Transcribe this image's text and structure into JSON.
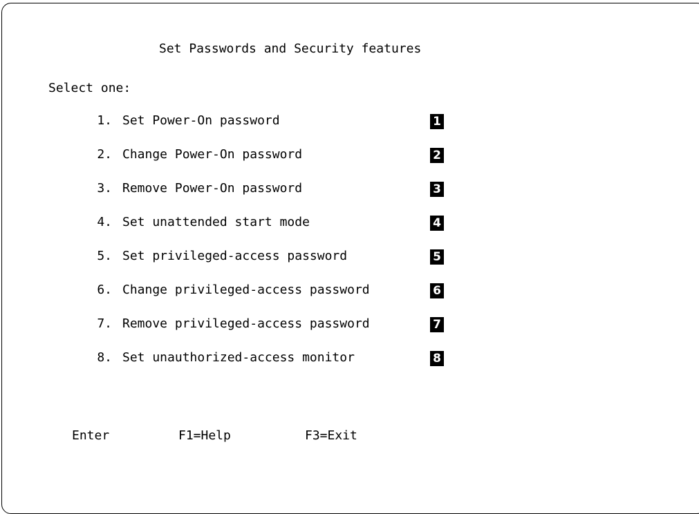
{
  "screen": {
    "title": "Set Passwords and Security features",
    "prompt": "Select one:"
  },
  "menu": {
    "items": [
      {
        "number": "1.",
        "label": "Set Power-On password",
        "callout": "1"
      },
      {
        "number": "2.",
        "label": "Change Power-On password",
        "callout": "2"
      },
      {
        "number": "3.",
        "label": "Remove Power-On password",
        "callout": "3"
      },
      {
        "number": "4.",
        "label": "Set unattended start mode",
        "callout": "4"
      },
      {
        "number": "5.",
        "label": "Set privileged-access password",
        "callout": "5"
      },
      {
        "number": "6.",
        "label": "Change privileged-access password",
        "callout": "6"
      },
      {
        "number": "7.",
        "label": "Remove privileged-access password",
        "callout": "7"
      },
      {
        "number": "8.",
        "label": "Set unauthorized-access monitor",
        "callout": "8"
      }
    ]
  },
  "function_keys": {
    "enter": "Enter",
    "help": "F1=Help",
    "exit": "F3=Exit"
  }
}
